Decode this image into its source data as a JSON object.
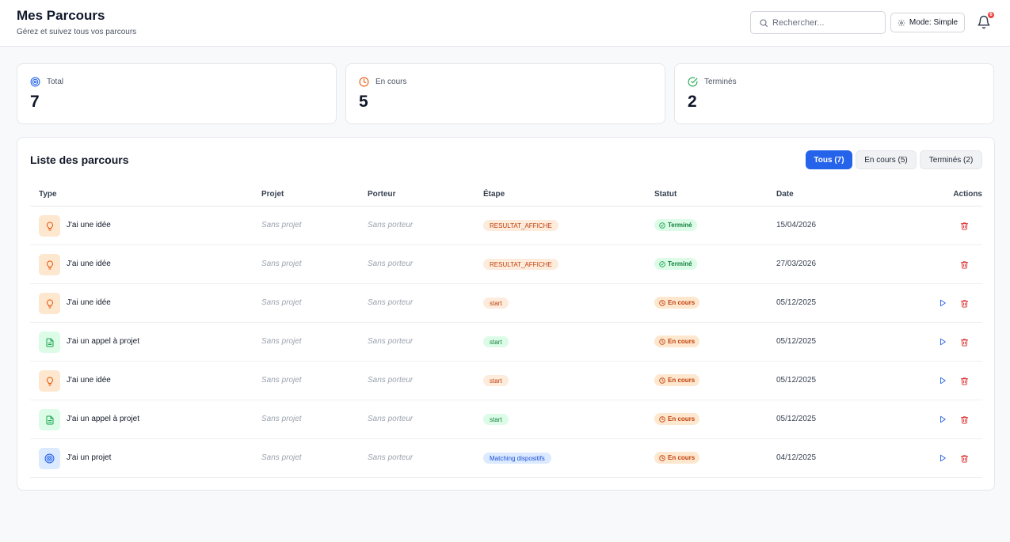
{
  "header": {
    "title": "Mes Parcours",
    "subtitle": "Gérez et suivez tous vos parcours",
    "search_placeholder": "Rechercher...",
    "search_value": "",
    "mode_label": "Mode: Simple",
    "notification_count": "6"
  },
  "stats": {
    "total": {
      "label": "Total",
      "value": "7",
      "icon": "target-icon",
      "color": "#2563eb"
    },
    "en_cours": {
      "label": "En cours",
      "value": "5",
      "icon": "clock-icon",
      "color": "#ea580c"
    },
    "termines": {
      "label": "Terminés",
      "value": "2",
      "icon": "check-circle-icon",
      "color": "#16a34a"
    }
  },
  "list": {
    "title": "Liste des parcours",
    "filters": [
      {
        "label": "Tous (7)",
        "active": true
      },
      {
        "label": "En cours (5)",
        "active": false
      },
      {
        "label": "Terminés (2)",
        "active": false
      }
    ],
    "columns": [
      "Type",
      "Projet",
      "Porteur",
      "Étape",
      "Statut",
      "Date",
      "Actions"
    ],
    "rows": [
      {
        "type": "J'ai une idée",
        "icon": "lightbulb-icon",
        "projet": "Sans projet",
        "porteur": "Sans porteur",
        "etape": "RESULTAT_AFFICHE",
        "statut": "Terminé",
        "date": "15/04/2026"
      },
      {
        "type": "J'ai une idée",
        "icon": "lightbulb-icon",
        "projet": "Sans projet",
        "porteur": "Sans porteur",
        "etape": "RESULTAT_AFFICHE",
        "statut": "Terminé",
        "date": "27/03/2026"
      },
      {
        "type": "J'ai une idée",
        "icon": "lightbulb-icon",
        "projet": "Sans projet",
        "porteur": "Sans porteur",
        "etape": "start",
        "statut": "En cours",
        "date": "05/12/2025"
      },
      {
        "type": "J'ai un appel à projet",
        "icon": "document-icon",
        "projet": "Sans projet",
        "porteur": "Sans porteur",
        "etape": "start",
        "statut": "En cours",
        "date": "05/12/2025"
      },
      {
        "type": "J'ai une idée",
        "icon": "lightbulb-icon",
        "projet": "Sans projet",
        "porteur": "Sans porteur",
        "etape": "start",
        "statut": "En cours",
        "date": "05/12/2025"
      },
      {
        "type": "J'ai un appel à projet",
        "icon": "document-icon",
        "projet": "Sans projet",
        "porteur": "Sans porteur",
        "etape": "start",
        "statut": "En cours",
        "date": "05/12/2025"
      },
      {
        "type": "J'ai un projet",
        "icon": "target-icon",
        "projet": "Sans projet",
        "porteur": "Sans porteur",
        "etape": "Matching dispositifs",
        "statut": "En cours",
        "date": "04/12/2025"
      }
    ]
  },
  "colors": {
    "accent": "#2563eb",
    "done": "#16a34a",
    "in_progress": "#ea580c",
    "danger": "#dc2626"
  }
}
